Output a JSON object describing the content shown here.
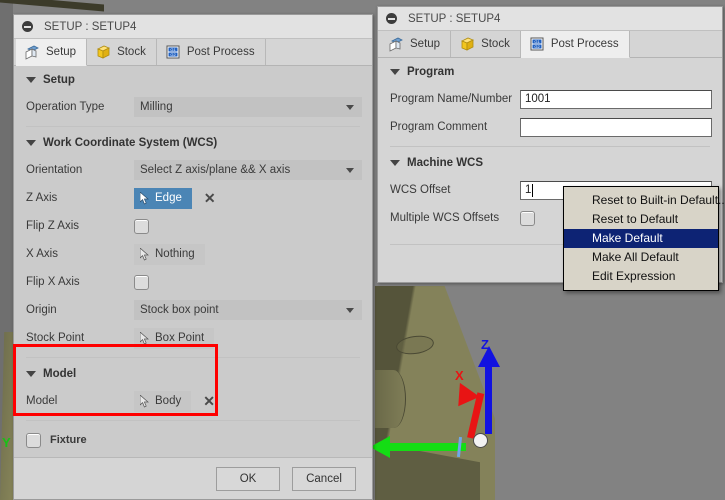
{
  "viewport": {
    "name": "cad-3d-viewport",
    "background_color": "#828282",
    "part_color": "#7e7c55",
    "triad": {
      "z_label": "Z",
      "z_color": "#1212e0",
      "x_label": "X",
      "x_color": "#e81414",
      "y_label": "Y",
      "y_color": "#14dd14"
    }
  },
  "left_dialog": {
    "title": "SETUP : SETUP4",
    "tabs": [
      {
        "label": "Setup",
        "icon": "setup-box-icon",
        "active": true
      },
      {
        "label": "Stock",
        "icon": "stock-box-icon",
        "active": false
      },
      {
        "label": "Post Process",
        "icon": "post-process-gcode-icon",
        "active": false
      }
    ],
    "sections": {
      "setup": {
        "heading": "Setup",
        "operation_type": {
          "label": "Operation Type",
          "value": "Milling"
        }
      },
      "wcs": {
        "heading": "Work Coordinate System (WCS)",
        "orientation": {
          "label": "Orientation",
          "value": "Select Z axis/plane && X axis"
        },
        "z_axis": {
          "label": "Z Axis",
          "value": "Edge",
          "selected": true
        },
        "flip_z_axis": {
          "label": "Flip Z Axis",
          "checked": false
        },
        "x_axis": {
          "label": "X Axis",
          "value": "Nothing",
          "selected": false
        },
        "flip_x_axis": {
          "label": "Flip X Axis",
          "checked": false
        },
        "origin": {
          "label": "Origin",
          "value": "Stock box point"
        },
        "stock_point": {
          "label": "Stock Point",
          "value": "Box Point",
          "selected": false
        }
      },
      "model": {
        "heading": "Model",
        "model": {
          "label": "Model",
          "value": "Body",
          "selected": false
        },
        "highlight_color": "#ff0000"
      },
      "fixture": {
        "label": "Fixture",
        "checked": false
      }
    },
    "footer": {
      "ok_label": "OK",
      "cancel_label": "Cancel"
    }
  },
  "right_dialog": {
    "title": "SETUP : SETUP4",
    "tabs": [
      {
        "label": "Setup",
        "icon": "setup-box-icon",
        "active": false
      },
      {
        "label": "Stock",
        "icon": "stock-box-icon",
        "active": false
      },
      {
        "label": "Post Process",
        "icon": "post-process-gcode-icon",
        "active": true
      }
    ],
    "sections": {
      "program": {
        "heading": "Program",
        "program_name_number": {
          "label": "Program Name/Number",
          "value": "1001",
          "placeholder": ""
        },
        "program_comment": {
          "label": "Program Comment",
          "value": "",
          "placeholder": ""
        }
      },
      "machine_wcs": {
        "heading": "Machine WCS",
        "wcs_offset": {
          "label": "WCS Offset",
          "value": "1",
          "placeholder": ""
        },
        "multiple_wcs_offsets": {
          "label": "Multiple WCS Offsets",
          "checked": false
        }
      }
    }
  },
  "context_menu": {
    "name": "wcs-offset-context-menu",
    "highlight_color": "#0d2374",
    "items": [
      {
        "label": "Reset to Built-in Default...",
        "selected": false
      },
      {
        "label": "Reset to Default",
        "selected": false
      },
      {
        "label": "Make Default",
        "selected": true
      },
      {
        "label": "Make All Default",
        "selected": false
      },
      {
        "label": "Edit Expression",
        "selected": false
      }
    ]
  }
}
